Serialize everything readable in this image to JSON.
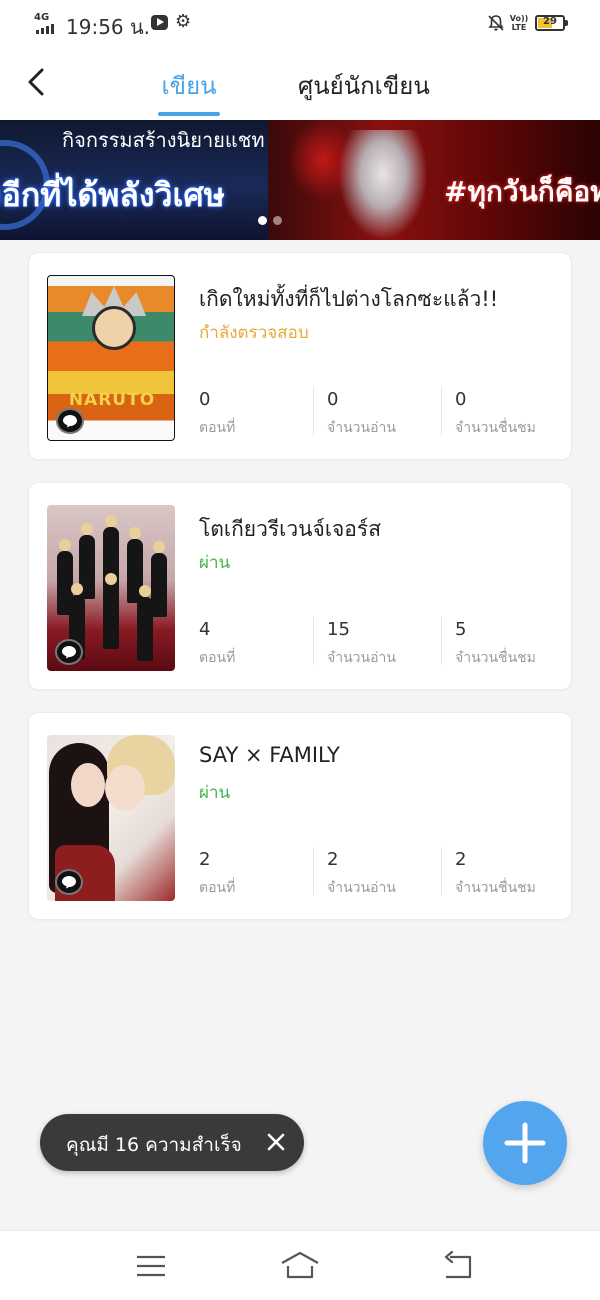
{
  "status_bar": {
    "network": "4G",
    "time": "19:56 น.",
    "lte": "Vo)) LTE",
    "battery": "29",
    "icons": [
      "signal-icon",
      "youtube-icon",
      "gear-icon",
      "bell-off-icon",
      "volte-icon",
      "battery-icon"
    ]
  },
  "header": {
    "back_icon": "chevron-left-icon",
    "tabs": [
      {
        "label": "เขียน",
        "active": true
      },
      {
        "label": "ศูนย์นักเขียน",
        "active": false
      }
    ]
  },
  "banner": {
    "left_text_top": "กิจกรรมสร้างนิยายแชท",
    "left_text_main": "งอีกที่ได้พลังวิเศษ",
    "right_text": "#ทุกวันก็คือทุ",
    "dots": 2,
    "active_dot": 0
  },
  "stories": [
    {
      "title": "เกิดใหม่ทั้งที่ก็ไปต่างโลกซะแล้ว!!",
      "status": "กำลังตรวจสอบ",
      "status_type": "review",
      "cover_text": "NARUTO",
      "stats": [
        {
          "value": "0",
          "label": "ตอนที่"
        },
        {
          "value": "0",
          "label": "จำนวนอ่าน"
        },
        {
          "value": "0",
          "label": "จำนวนชื่นชม"
        }
      ]
    },
    {
      "title": "โตเกียวรีเวนจ์เจอร์ส",
      "status": "ผ่าน",
      "status_type": "pass",
      "stats": [
        {
          "value": "4",
          "label": "ตอนที่"
        },
        {
          "value": "15",
          "label": "จำนวนอ่าน"
        },
        {
          "value": "5",
          "label": "จำนวนชื่นชม"
        }
      ]
    },
    {
      "title": "SAY × FAMILY",
      "status": "ผ่าน",
      "status_type": "pass",
      "stats": [
        {
          "value": "2",
          "label": "ตอนที่"
        },
        {
          "value": "2",
          "label": "จำนวนอ่าน"
        },
        {
          "value": "2",
          "label": "จำนวนชื่นชม"
        }
      ]
    }
  ],
  "toast": {
    "text": "คุณมี 16 ความสำเร็จ",
    "close_icon": "close-icon"
  },
  "fab": {
    "icon": "plus-icon"
  },
  "nav_bar": {
    "icons": [
      "menu-icon",
      "home-icon",
      "back-icon"
    ]
  },
  "colors": {
    "accent": "#4aa3e8",
    "fab": "#53a6ed",
    "status_review": "#e8a93a",
    "status_pass": "#41b64a",
    "toast_bg": "#3a3a3a",
    "page_bg": "#f4f4f4"
  }
}
